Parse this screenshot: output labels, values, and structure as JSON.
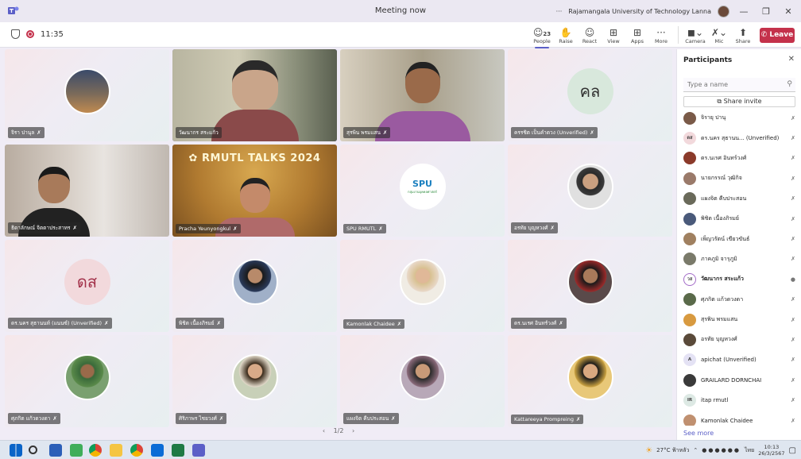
{
  "window": {
    "title": "Meeting now",
    "org": "Rajamangala University of Technology Lanna",
    "ellipsis": "···",
    "min": "—",
    "restore": "❐",
    "close": "✕"
  },
  "toolbar": {
    "timer": "11:35",
    "people_count": "23",
    "items": [
      {
        "label": "People",
        "icon": "☺"
      },
      {
        "label": "Raise",
        "icon": "✋"
      },
      {
        "label": "React",
        "icon": "☺"
      },
      {
        "label": "View",
        "icon": "⊞"
      },
      {
        "label": "Apps",
        "icon": "⊞"
      },
      {
        "label": "More",
        "icon": "···"
      }
    ],
    "camera": "Camera",
    "mic": "Mic",
    "share": "Share",
    "leave": "Leave"
  },
  "tiles": [
    {
      "name": "จิรา ปานุล"
    },
    {
      "name": "วัฒนากร สระแก้ว"
    },
    {
      "name": "สุรพิน พรมแสน"
    },
    {
      "name": "ครรชิต เป็นคำดวง (Unverified)",
      "initials": "คล"
    },
    {
      "name": "ธิดาลักษณ์ จิตตาประสาทร"
    },
    {
      "name": "Pracha Yeunyongkul",
      "banner": "RMUTL TALKS 2024"
    },
    {
      "name": "SPU RMUTL",
      "logo": "SPU",
      "logo_sub": "กลุ่มงานบุคคลศาสตร์"
    },
    {
      "name": "อรทัย บุญหวงศ์"
    },
    {
      "name": "ดร.นคร สุธานนท์ (แนนซ์) (Unverified)",
      "initials": "ดส"
    },
    {
      "name": "พิชิต เนื้องภิรมย์"
    },
    {
      "name": "Kamonlak Chaidee"
    },
    {
      "name": "ดร.นเรศ อินทร์วงศ์"
    },
    {
      "name": "ศุภกิต แก้วดวงดา"
    },
    {
      "name": "ศิริภาพร ไชยวงศ์"
    },
    {
      "name": "แผงจิต คีบประสอน"
    },
    {
      "name": "Kattareeya Prompreing"
    }
  ],
  "pager": {
    "prev": "‹",
    "text": "1/2",
    "next": "›"
  },
  "panel": {
    "title": "Participants",
    "close": "✕",
    "search_placeholder": "Type a name",
    "share_invite": "Share invite",
    "see_more": "See more",
    "participants": [
      {
        "name": "จิรายุ ปานุ",
        "initials": "",
        "color": "#7a5a48"
      },
      {
        "name": "ดร.นคร สุธานน... (Unverified)",
        "initials": "ดส",
        "color": "#f2d9dc"
      },
      {
        "name": "ดร.นเรศ อินทร์วงศ์",
        "initials": "",
        "color": "#8b3a2a"
      },
      {
        "name": "นายกรรณ์ วุฒิกิจ",
        "initials": "",
        "color": "#9a7a6a"
      },
      {
        "name": "แผงจิต คีบประสอน",
        "initials": "",
        "color": "#6a6a5a"
      },
      {
        "name": "พิชิต เนื้องภิรมย์",
        "initials": "",
        "color": "#4a5a7a"
      },
      {
        "name": "เพ็ญวรัตน์ เขียวขันธ์",
        "initials": "",
        "color": "#a08060"
      },
      {
        "name": "ภาคภูมิ จารุภูมิ",
        "initials": "",
        "color": "#7a7a6a"
      },
      {
        "name": "วัฒนากร สระแก้ว",
        "initials": "วส",
        "color": "#ffffff",
        "bold": true
      },
      {
        "name": "ศุภกิต แก้วดวงดา",
        "initials": "",
        "color": "#5a6a4a"
      },
      {
        "name": "สุรพิน พรมแสน",
        "initials": "",
        "color": "#d89a40"
      },
      {
        "name": "อรทัย บุญหวงศ์",
        "initials": "",
        "color": "#5a4a3a"
      },
      {
        "name": "apichat (Unverified)",
        "initials": "A",
        "color": "#e4e2f4"
      },
      {
        "name": "GRAILARD DORNCHAI",
        "initials": "",
        "color": "#3a3a3a"
      },
      {
        "name": "itap rmutl",
        "initials": "IR",
        "color": "#dde9e4"
      },
      {
        "name": "Kamonlak Chaidee",
        "initials": "",
        "color": "#c09070"
      }
    ]
  },
  "taskbar": {
    "weather": "27°C ฟ้าหลัว",
    "lang": "ไทย",
    "time": "10:13",
    "date": "26/3/2567"
  },
  "colors": {
    "accent": "#5b5fc7",
    "leave": "#c4314b"
  }
}
